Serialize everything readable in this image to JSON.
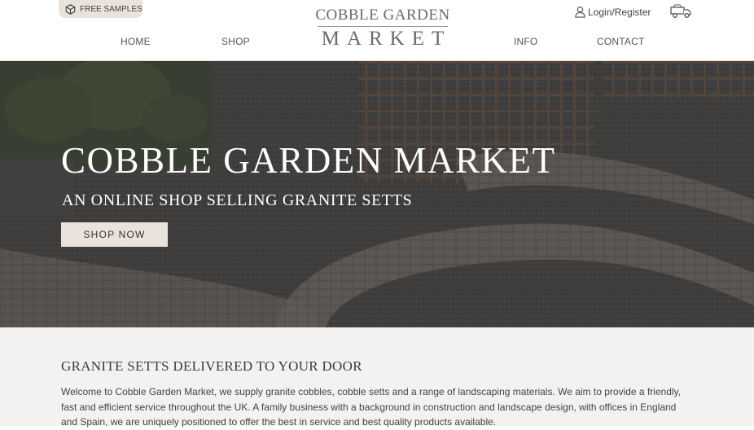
{
  "header": {
    "free_samples_label": "FREE SAMPLES",
    "logo_line1": "COBBLE GARDEN",
    "logo_line2": "MARKET",
    "login_label": "Login/Register",
    "nav": {
      "home": "HOME",
      "shop": "SHOP",
      "info": "INFO",
      "contact": "CONTACT"
    }
  },
  "hero": {
    "title": "COBBLE GARDEN MARKET",
    "subtitle": "AN ONLINE SHOP SELLING GRANITE SETTS",
    "button_label": "SHOP NOW"
  },
  "intro": {
    "title": "GRANITE SETTS DELIVERED TO YOUR DOOR",
    "text": "Welcome to Cobble Garden Market, we supply granite cobbles, cobble setts and a range of landscaping materials. We aim to provide a friendly, fast and efficient service throughout the UK. A family business with a background in construction and landscape design, with offices in England and Spain, we are uniquely positioned to offer the best in service and best quality products available."
  },
  "icons": {
    "free_samples": "box-icon",
    "login": "user-icon",
    "cart": "truck-cart-icon"
  },
  "colors": {
    "accent_beige": "#e9e3db",
    "header_text": "#555555",
    "hero_overlay": "#3a3936"
  }
}
